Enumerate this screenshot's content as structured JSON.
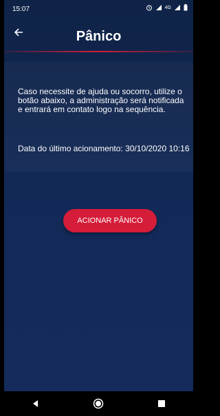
{
  "status": {
    "time": "15:07",
    "network": "4G"
  },
  "header": {
    "title": "Pânico",
    "back_icon": "arrow-left-icon"
  },
  "content": {
    "description": "Caso necessite de ajuda ou socorro, utilize o botão abaixo, a administração será notificada e entrará em contato logo na sequência.",
    "last_activation": "Data do último acionamento: 30/10/2020 10:16"
  },
  "actions": {
    "panic_button": "ACIONAR PÂNICO"
  },
  "colors": {
    "accent": "#d51d39",
    "background": "#132a59"
  }
}
